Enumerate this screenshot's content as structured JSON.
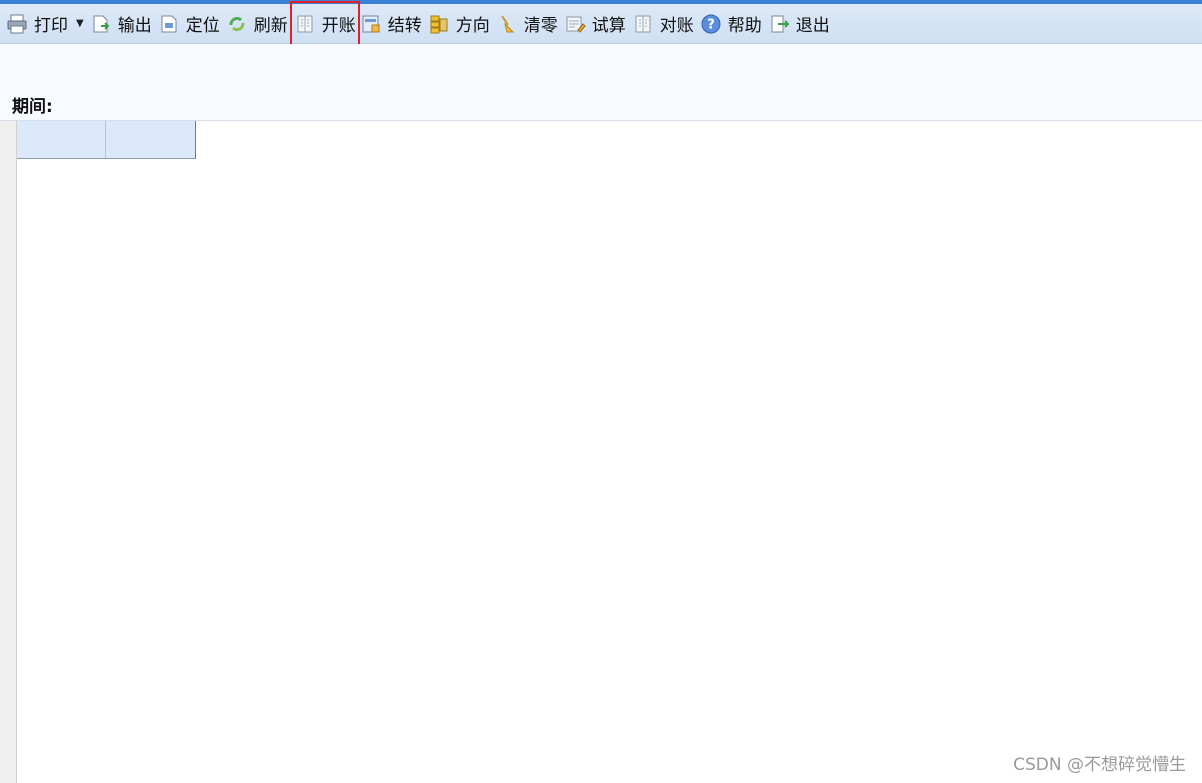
{
  "toolbar": {
    "items": [
      {
        "label": "打印",
        "icon": "printer-icon",
        "has_dropdown": true
      },
      {
        "label": "输出",
        "icon": "export-icon"
      },
      {
        "label": "定位",
        "icon": "locate-icon"
      },
      {
        "label": "刷新",
        "icon": "refresh-icon"
      },
      {
        "label": "开账",
        "icon": "open-account-icon",
        "highlighted": true
      },
      {
        "label": "结转",
        "icon": "carry-forward-icon"
      },
      {
        "label": "方向",
        "icon": "direction-icon"
      },
      {
        "label": "清零",
        "icon": "broom-icon"
      },
      {
        "label": "试算",
        "icon": "trial-balance-icon"
      },
      {
        "label": "对账",
        "icon": "reconcile-icon"
      },
      {
        "label": "帮助",
        "icon": "help-icon"
      },
      {
        "label": "退出",
        "icon": "exit-icon"
      }
    ],
    "highlight_color": "#e0202a",
    "accent_color": "#3b82d6"
  },
  "filter": {
    "period_label": "期间:"
  },
  "grid": {
    "columns": [
      "",
      ""
    ]
  },
  "watermark": "CSDN @不想碎觉懵生"
}
